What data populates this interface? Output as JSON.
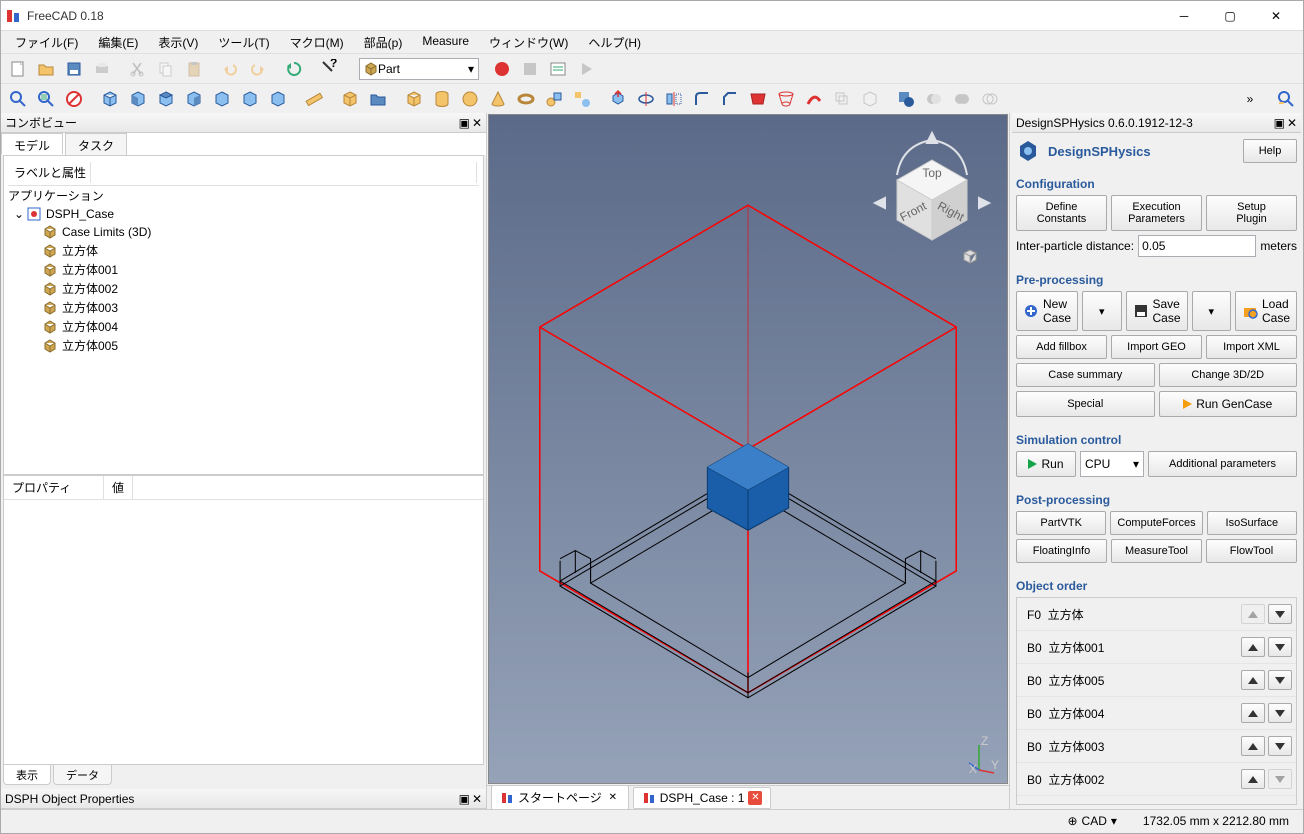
{
  "titlebar": {
    "title": "FreeCAD 0.18"
  },
  "menu": [
    "ファイル(F)",
    "編集(E)",
    "表示(V)",
    "ツール(T)",
    "マクロ(M)",
    "部品(p)",
    "Measure",
    "ウィンドウ(W)",
    "ヘルプ(H)"
  ],
  "workbench": "Part",
  "left": {
    "panel_title": "コンボビュー",
    "tabs": [
      "モデル",
      "タスク"
    ],
    "tree_headers": [
      "ラベルと属性",
      ""
    ],
    "tree_root": "アプリケーション",
    "tree_group": "DSPH_Case",
    "tree_items": [
      "Case Limits (3D)",
      "立方体",
      "立方体001",
      "立方体002",
      "立方体003",
      "立方体004",
      "立方体005"
    ],
    "prop_headers": [
      "プロパティ",
      "値"
    ],
    "bottom_tabs": [
      "表示",
      "データ"
    ],
    "bottom_panel": "DSPH Object Properties"
  },
  "doctabs": [
    {
      "label": "スタートページ",
      "close": "plain"
    },
    {
      "label": "DSPH_Case : 1",
      "close": "red"
    }
  ],
  "right": {
    "panel_title": "DesignSPHysics 0.6.0.1912-12-3",
    "brand": "DesignSPHysics",
    "help": "Help",
    "config_title": "Configuration",
    "config_buttons": [
      "Define\nConstants",
      "Execution\nParameters",
      "Setup\nPlugin"
    ],
    "ipd_label": "Inter-particle distance:",
    "ipd_value": "0.05",
    "ipd_unit": "meters",
    "preproc_title": "Pre-processing",
    "new_case": "New\nCase",
    "save_case": "Save\nCase",
    "load_case": "Load\nCase",
    "add_fillbox": "Add fillbox",
    "import_geo": "Import GEO",
    "import_xml": "Import XML",
    "case_summary": "Case summary",
    "change_3d2d": "Change 3D/2D",
    "special": "Special",
    "run_gencase": "Run GenCase",
    "sim_title": "Simulation control",
    "run": "Run",
    "cpu": "CPU",
    "add_params": "Additional parameters",
    "post_title": "Post-processing",
    "post_buttons": [
      "PartVTK",
      "ComputeForces",
      "IsoSurface",
      "FloatingInfo",
      "MeasureTool",
      "FlowTool"
    ],
    "object_order_title": "Object order",
    "objects": [
      {
        "tag": "F0",
        "name": "立方体",
        "up": false,
        "down": true
      },
      {
        "tag": "B0",
        "name": "立方体001",
        "up": true,
        "down": true
      },
      {
        "tag": "B0",
        "name": "立方体005",
        "up": true,
        "down": true
      },
      {
        "tag": "B0",
        "name": "立方体004",
        "up": true,
        "down": true
      },
      {
        "tag": "B0",
        "name": "立方体003",
        "up": true,
        "down": true
      },
      {
        "tag": "B0",
        "name": "立方体002",
        "up": true,
        "down": false
      }
    ]
  },
  "status": {
    "mode_icon": "⊕",
    "mode": "CAD",
    "coords": "1732.05 mm x 2212.80 mm"
  }
}
